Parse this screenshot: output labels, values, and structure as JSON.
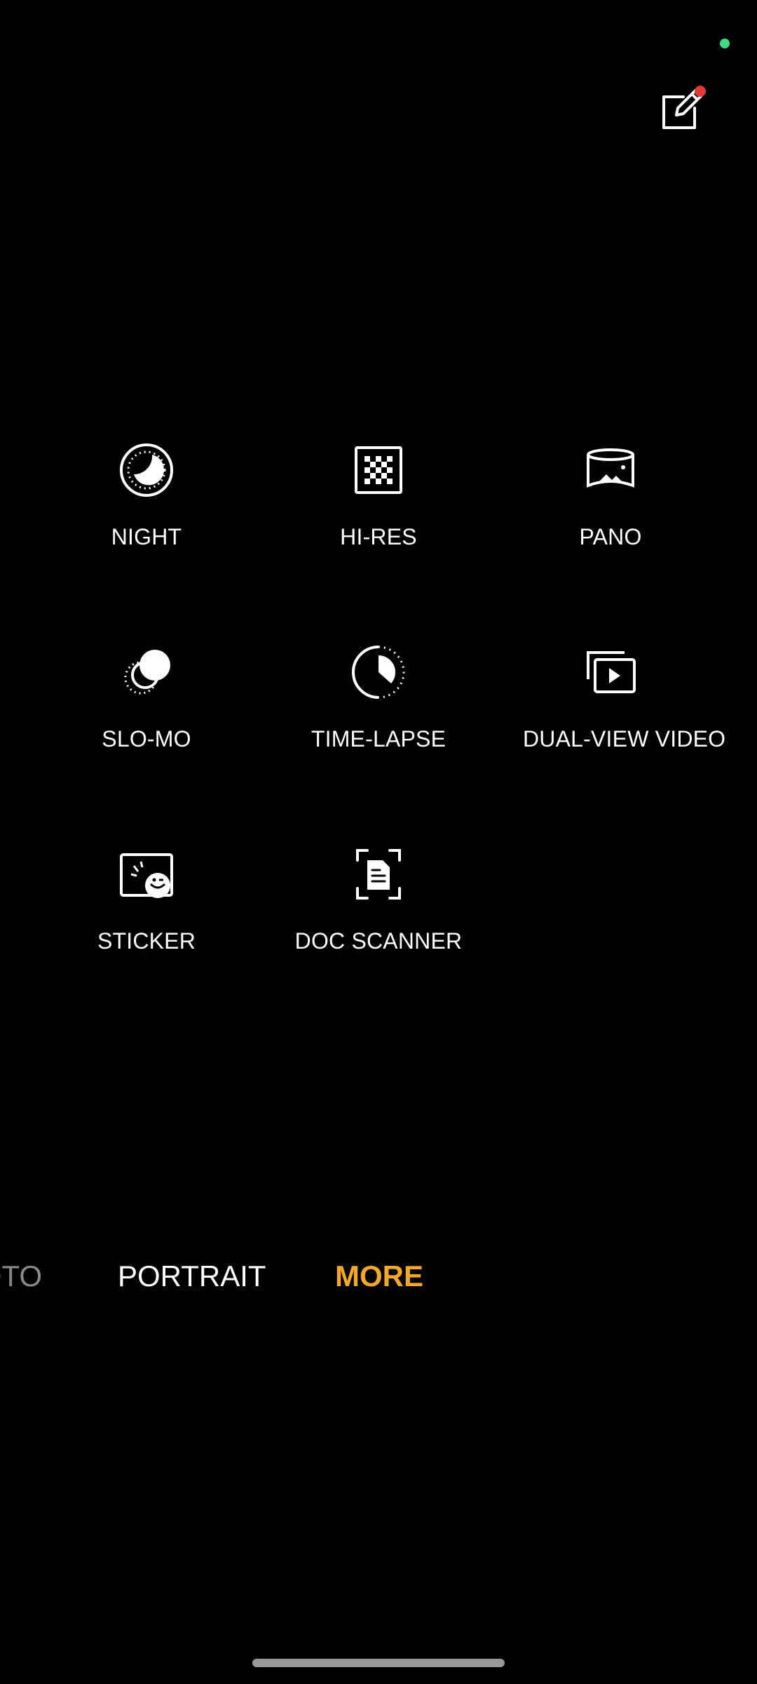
{
  "status": {
    "privacy_indicator_color": "#3ddc84"
  },
  "top_controls": {
    "edit_icon": "edit-pencil-icon",
    "notification_dot_color": "#e53935"
  },
  "modes": [
    {
      "label": "NIGHT",
      "icon": "moon-icon"
    },
    {
      "label": "HI-RES",
      "icon": "hi-res-grid-icon"
    },
    {
      "label": "PANO",
      "icon": "panorama-icon"
    },
    {
      "label": "SLO-MO",
      "icon": "slow-motion-icon"
    },
    {
      "label": "TIME-LAPSE",
      "icon": "time-lapse-icon"
    },
    {
      "label": "DUAL-VIEW VIDEO",
      "icon": "dual-view-video-icon"
    },
    {
      "label": "STICKER",
      "icon": "sticker-icon"
    },
    {
      "label": "DOC SCANNER",
      "icon": "document-scanner-icon"
    }
  ],
  "mode_bar": {
    "photo": "PHOTO",
    "portrait": "PORTRAIT",
    "more": "MORE",
    "active_color": "#f4a926"
  }
}
